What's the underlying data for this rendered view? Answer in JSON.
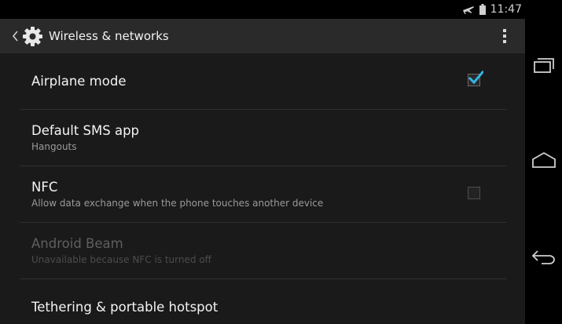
{
  "status_bar": {
    "time": "11:47",
    "icons": [
      "airplane-icon",
      "battery-icon"
    ]
  },
  "action_bar": {
    "title": "Wireless & networks",
    "icons": [
      "up-caret-icon",
      "settings-gear-icon",
      "overflow-menu-icon"
    ]
  },
  "settings": [
    {
      "title": "Airplane mode",
      "summary": "",
      "checkbox": true,
      "checked": true,
      "enabled": true
    },
    {
      "title": "Default SMS app",
      "summary": "Hangouts",
      "checkbox": false,
      "enabled": true
    },
    {
      "title": "NFC",
      "summary": "Allow data exchange when the phone touches another device",
      "checkbox": true,
      "checked": false,
      "enabled": true
    },
    {
      "title": "Android Beam",
      "summary": "Unavailable because NFC is turned off",
      "checkbox": false,
      "enabled": false
    },
    {
      "title": "Tethering & portable hotspot",
      "summary": "",
      "checkbox": false,
      "enabled": true
    }
  ],
  "nav_bar": {
    "icons": [
      "recent-apps-icon",
      "home-icon",
      "back-icon"
    ]
  },
  "colors": {
    "accent": "#33b5e5",
    "background": "#1a1a1a",
    "action_bar": "#2a2a2a"
  }
}
